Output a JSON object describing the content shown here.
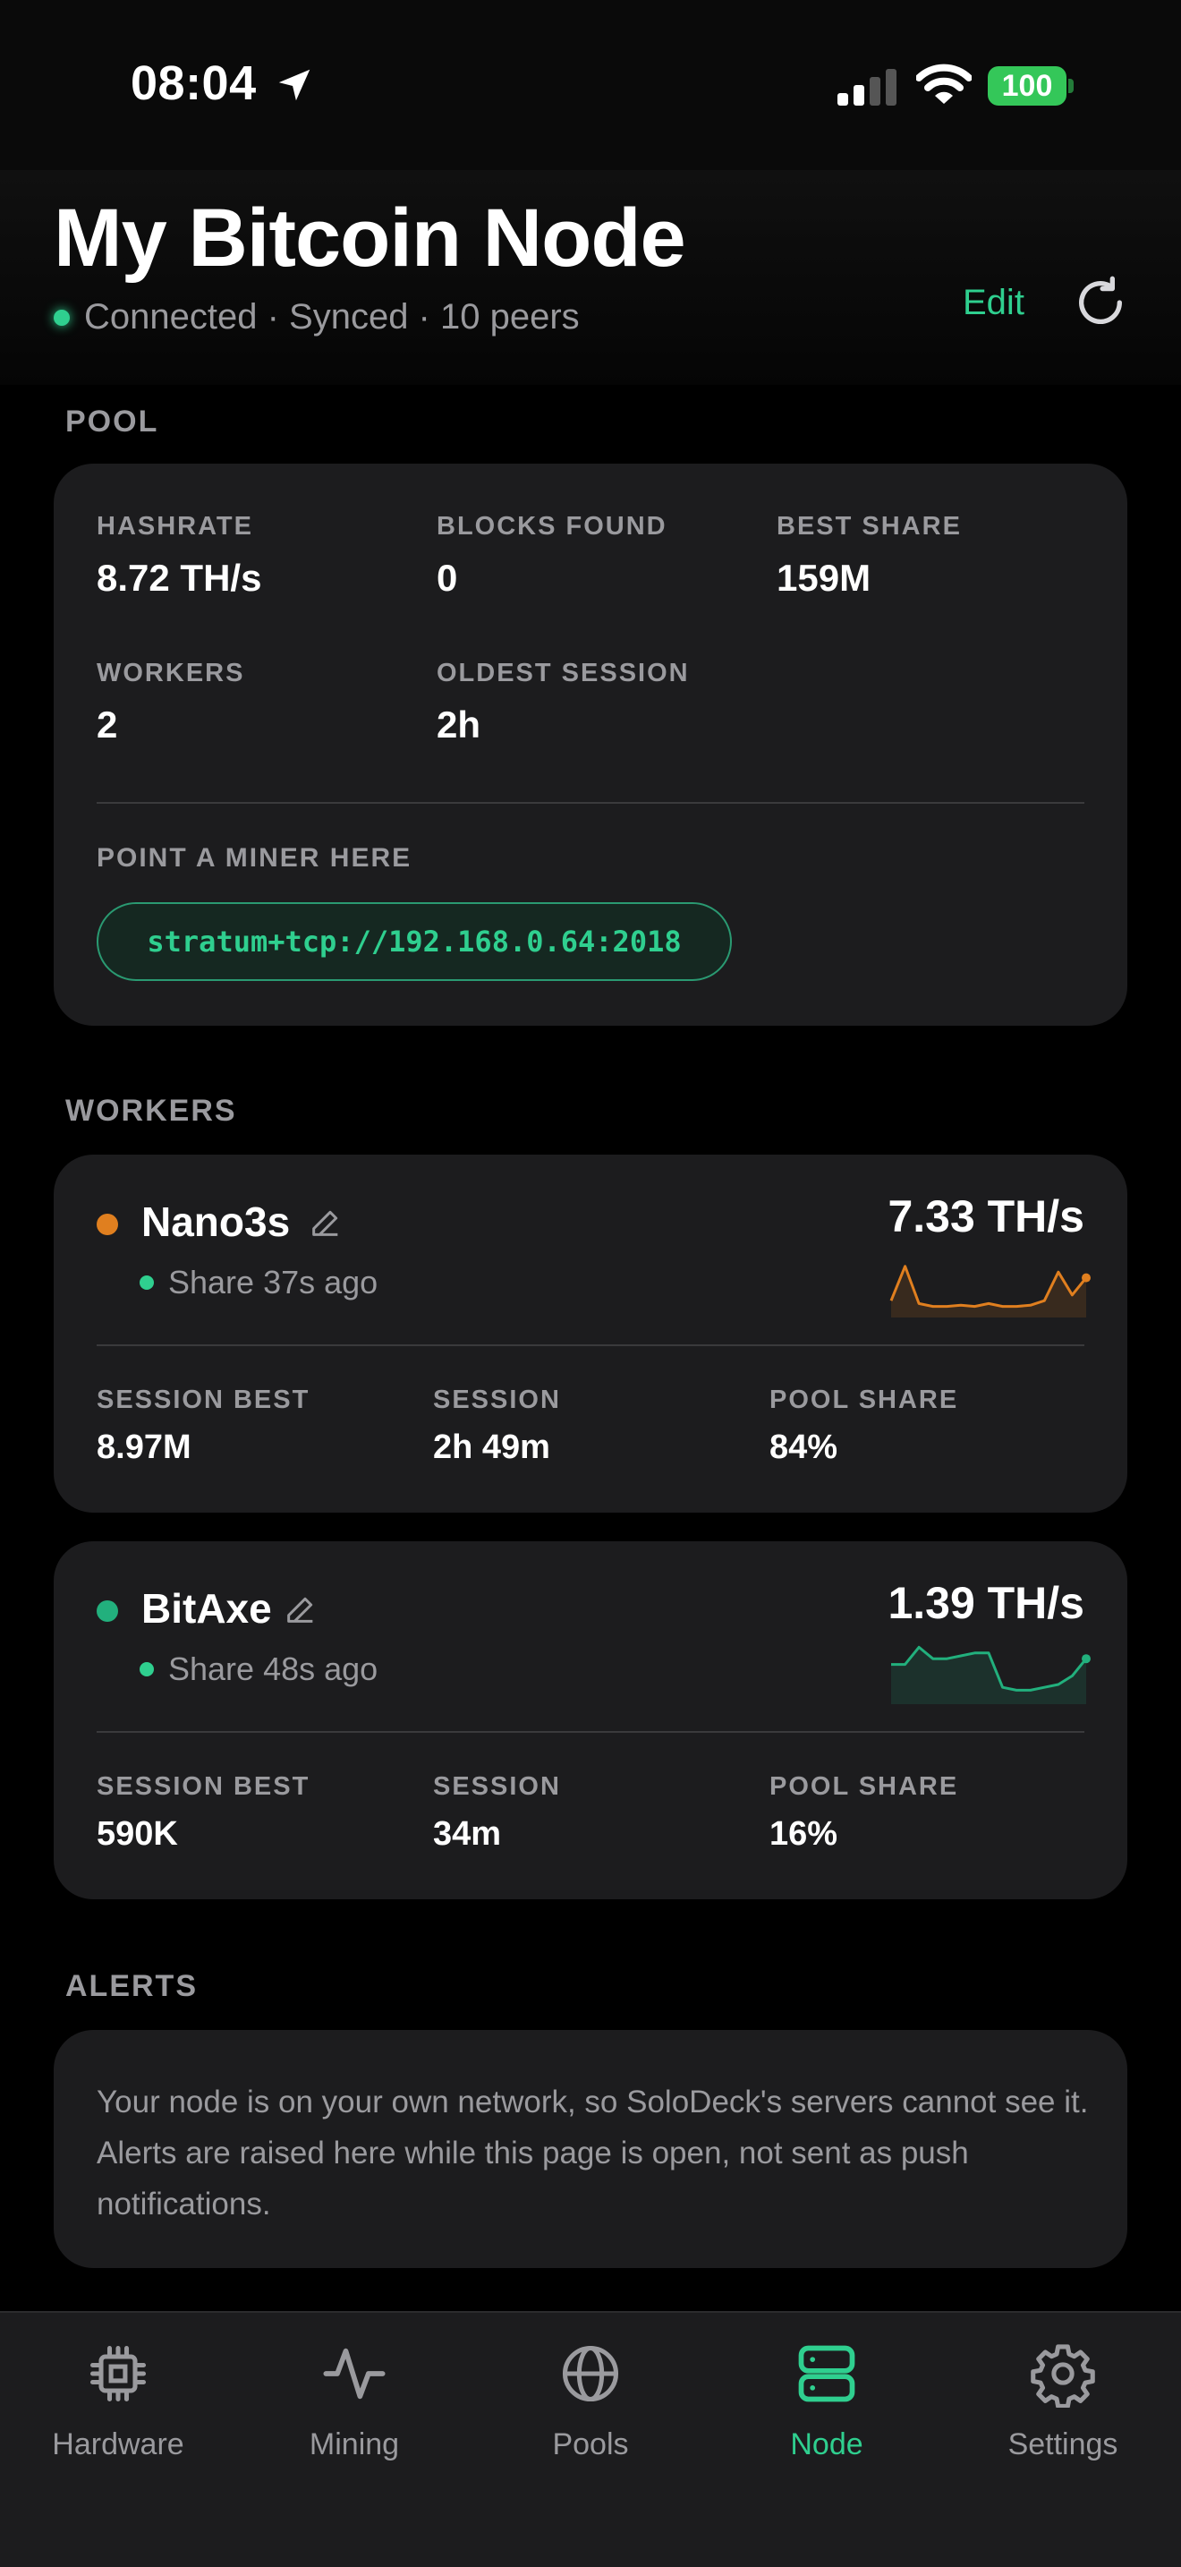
{
  "status_bar": {
    "time": "08:04",
    "battery": "100"
  },
  "header": {
    "title": "My Bitcoin Node",
    "status": "Connected · Synced · 10 peers",
    "edit_label": "Edit"
  },
  "pool": {
    "section_label": "POOL",
    "stats": [
      {
        "label": "HASHRATE",
        "value": "8.72 TH/s"
      },
      {
        "label": "BLOCKS FOUND",
        "value": "0"
      },
      {
        "label": "BEST SHARE",
        "value": "159M"
      },
      {
        "label": "WORKERS",
        "value": "2"
      },
      {
        "label": "OLDEST SESSION",
        "value": "2h"
      }
    ],
    "miner_label": "POINT A MINER HERE",
    "stratum_url": "stratum+tcp://192.168.0.64:2018"
  },
  "workers": {
    "section_label": "WORKERS",
    "items": [
      {
        "name": "Nano3s",
        "status_color": "#e07f1f",
        "last_share": "Share 37s ago",
        "hashrate": "7.33 TH/s",
        "sparkline_color": "#e07f1f",
        "sparkline": [
          0.2,
          0.8,
          0.15,
          0.1,
          0.1,
          0.12,
          0.1,
          0.15,
          0.1,
          0.1,
          0.12,
          0.2,
          0.7,
          0.3,
          0.6
        ],
        "stats": [
          {
            "label": "SESSION BEST",
            "value": "8.97M"
          },
          {
            "label": "SESSION",
            "value": "2h 49m"
          },
          {
            "label": "POOL SHARE",
            "value": "84%"
          }
        ]
      },
      {
        "name": "BitAxe",
        "status_color": "#22b07d",
        "last_share": "Share 48s ago",
        "hashrate": "1.39 TH/s",
        "sparkline_color": "#22b07d",
        "sparkline": [
          0.6,
          0.6,
          0.9,
          0.7,
          0.7,
          0.75,
          0.8,
          0.8,
          0.2,
          0.15,
          0.15,
          0.2,
          0.25,
          0.4,
          0.7
        ],
        "stats": [
          {
            "label": "SESSION BEST",
            "value": "590K"
          },
          {
            "label": "SESSION",
            "value": "34m"
          },
          {
            "label": "POOL SHARE",
            "value": "16%"
          }
        ]
      }
    ]
  },
  "alerts": {
    "section_label": "ALERTS",
    "text": "Your node is on your own network, so SoloDeck's servers cannot see it. Alerts are raised here while this page is open, not sent as push notifications."
  },
  "tabs": [
    {
      "label": "Hardware",
      "icon": "chip-icon",
      "active": false
    },
    {
      "label": "Mining",
      "icon": "pulse-icon",
      "active": false
    },
    {
      "label": "Pools",
      "icon": "globe-icon",
      "active": false
    },
    {
      "label": "Node",
      "icon": "server-icon",
      "active": true
    },
    {
      "label": "Settings",
      "icon": "gear-icon",
      "active": false
    }
  ],
  "colors": {
    "accent": "#2fcf8f",
    "background": "#000000",
    "card": "#1c1c1e"
  }
}
